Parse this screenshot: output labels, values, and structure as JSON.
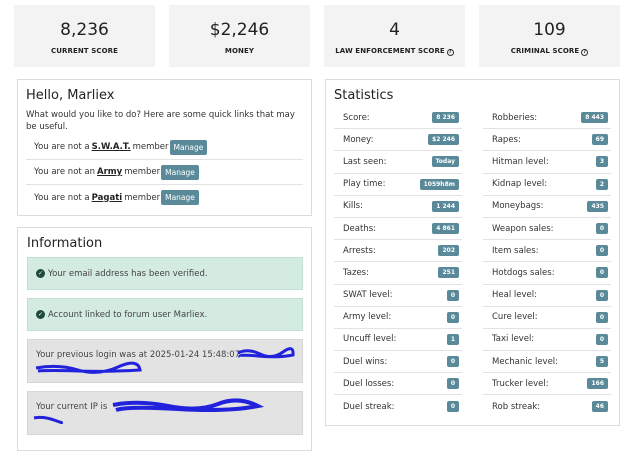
{
  "summary": [
    {
      "value": "8,236",
      "label": "CURRENT SCORE",
      "help": false
    },
    {
      "value": "$2,246",
      "label": "MONEY",
      "help": false
    },
    {
      "value": "4",
      "label": "LAW ENFORCEMENT SCORE",
      "help": true
    },
    {
      "value": "109",
      "label": "CRIMINAL SCORE",
      "help": true
    }
  ],
  "hello": {
    "title": "Hello, Marliex",
    "intro": "What would you like to do? Here are some quick links that may be useful.",
    "groups": [
      {
        "prefix": "You are not a",
        "name": "S.W.A.T.",
        "suffix": "member",
        "button": "Manage"
      },
      {
        "prefix": "You are not an",
        "name": "Army",
        "suffix": "member",
        "button": "Manage"
      },
      {
        "prefix": "You are not a",
        "name": "Pagati",
        "suffix": "member",
        "button": "Manage"
      }
    ]
  },
  "info": {
    "title": "Information",
    "email_verified": "Your email address has been verified.",
    "forum_link": "Account linked to forum user Marliex.",
    "last_login": "Your previous login was at 2025-01-24 15:48:07",
    "current_ip": "Your current IP is"
  },
  "statistics": {
    "title": "Statistics",
    "left": [
      {
        "label": "Score:",
        "value": "8 236"
      },
      {
        "label": "Money:",
        "value": "$2 246"
      },
      {
        "label": "Last seen:",
        "value": "Today"
      },
      {
        "label": "Play time:",
        "value": "1059h8m"
      },
      {
        "label": "Kills:",
        "value": "1 244"
      },
      {
        "label": "Deaths:",
        "value": "4 861"
      },
      {
        "label": "Arrests:",
        "value": "202"
      },
      {
        "label": "Tazes:",
        "value": "251"
      },
      {
        "label": "SWAT level:",
        "value": "0"
      },
      {
        "label": "Army level:",
        "value": "0"
      },
      {
        "label": "Uncuff level:",
        "value": "1"
      },
      {
        "label": "Duel wins:",
        "value": "0"
      },
      {
        "label": "Duel losses:",
        "value": "0"
      },
      {
        "label": "Duel streak:",
        "value": "0"
      }
    ],
    "right": [
      {
        "label": "Robberies:",
        "value": "8 443"
      },
      {
        "label": "Rapes:",
        "value": "69"
      },
      {
        "label": "Hitman level:",
        "value": "3"
      },
      {
        "label": "Kidnap level:",
        "value": "2"
      },
      {
        "label": "Moneybags:",
        "value": "435"
      },
      {
        "label": "Weapon sales:",
        "value": "0"
      },
      {
        "label": "Item sales:",
        "value": "0"
      },
      {
        "label": "Hotdogs sales:",
        "value": "0"
      },
      {
        "label": "Heal level:",
        "value": "0"
      },
      {
        "label": "Cure level:",
        "value": "0"
      },
      {
        "label": "Taxi level:",
        "value": "0"
      },
      {
        "label": "Mechanic level:",
        "value": "5"
      },
      {
        "label": "Trucker level:",
        "value": "166"
      },
      {
        "label": "Rob streak:",
        "value": "46"
      }
    ]
  }
}
